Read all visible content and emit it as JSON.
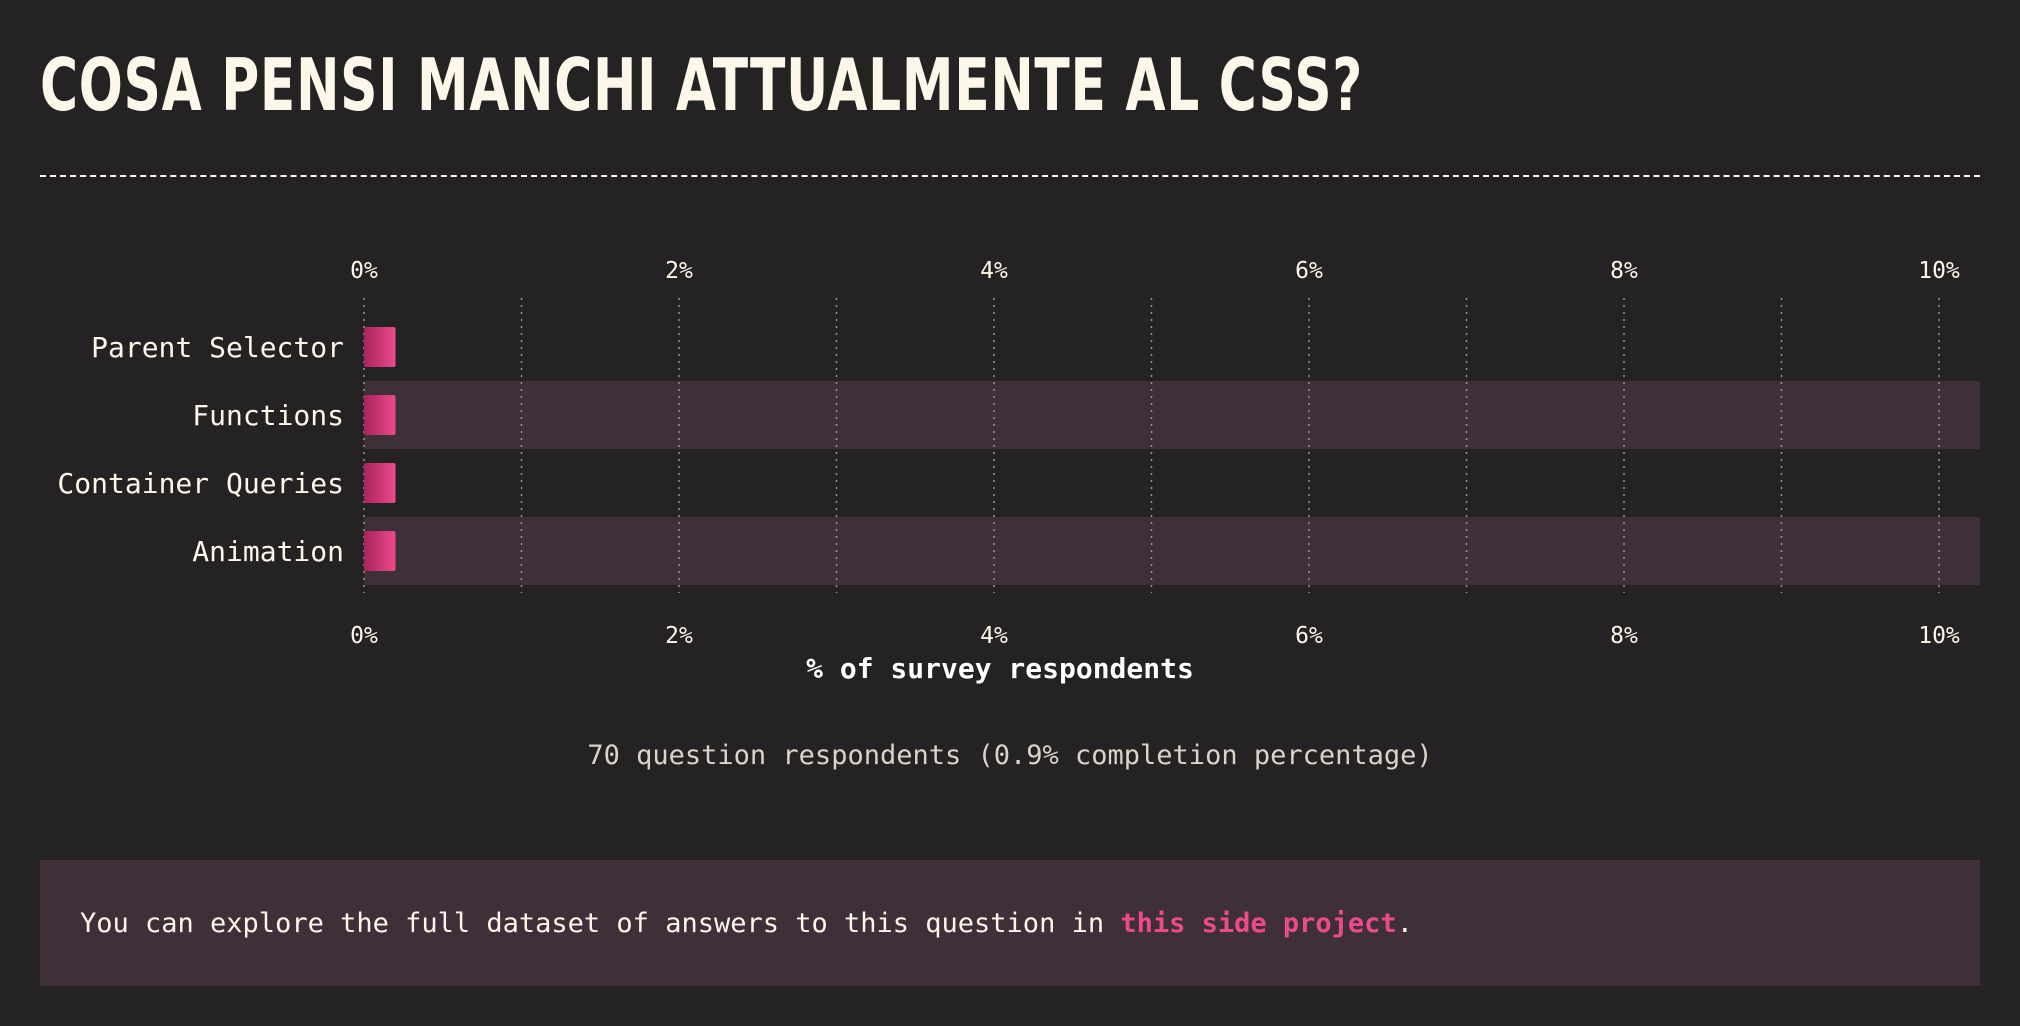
{
  "page": {
    "title": "COSA PENSI MANCHI ATTUALMENTE AL CSS?",
    "respondents_text": "70 question respondents (0.9% completion percentage)",
    "note": {
      "text_before": "You can explore the full dataset of answers to this question in ",
      "link_label": "this side project",
      "text_after": "."
    }
  },
  "colors": {
    "background": "#252224",
    "row_band": "#3e2f38",
    "bar_start": "#a8245c",
    "bar_end": "#ec4a8c",
    "text": "#fdf7ea",
    "link": "#ec4a8c"
  },
  "chart_data": {
    "type": "bar",
    "orientation": "horizontal",
    "categories": [
      "Parent Selector",
      "Functions",
      "Container Queries",
      "Animation"
    ],
    "values": [
      0.2,
      0.2,
      0.2,
      0.2
    ],
    "xlim": [
      0,
      10
    ],
    "xticks": [
      0,
      2,
      4,
      6,
      8,
      10
    ],
    "xtick_labels": [
      "0%",
      "2%",
      "4%",
      "6%",
      "8%",
      "10%"
    ],
    "xlabel": "% of survey respondents",
    "grid": true
  }
}
